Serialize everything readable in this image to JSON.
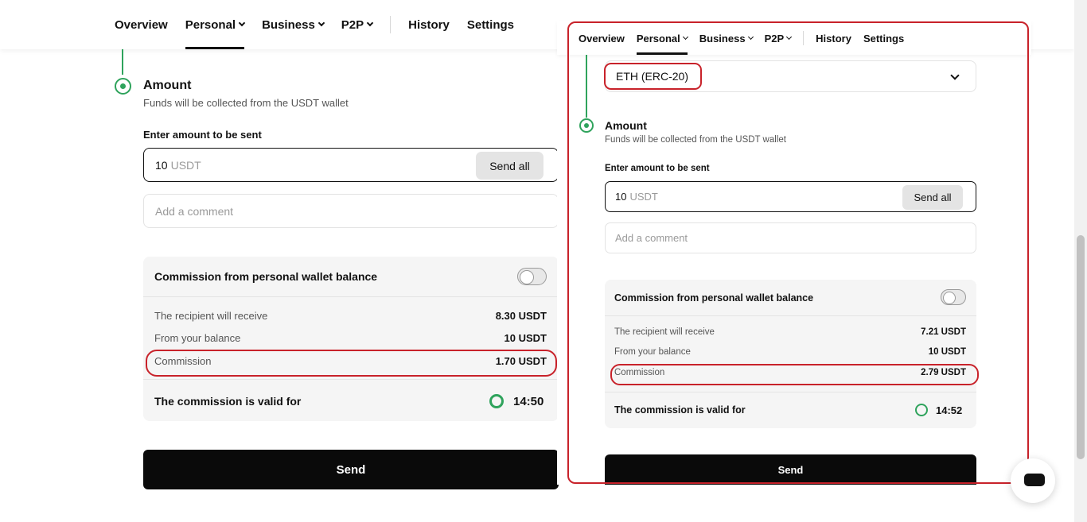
{
  "nav": {
    "items": [
      {
        "label": "Overview",
        "dropdown": false,
        "active": false
      },
      {
        "label": "Personal",
        "dropdown": true,
        "active": true
      },
      {
        "label": "Business",
        "dropdown": true,
        "active": false
      },
      {
        "label": "P2P",
        "dropdown": true,
        "active": false
      }
    ],
    "history": "History",
    "settings": "Settings"
  },
  "left": {
    "title": "Amount",
    "subtitle": "Funds will be collected from the USDT wallet",
    "amount_label": "Enter amount to be sent",
    "amount_value": "10",
    "amount_unit": "USDT",
    "send_all": "Send all",
    "comment_placeholder": "Add a comment",
    "commission_toggle_label": "Commission from personal wallet balance",
    "recipient_label": "The recipient will receive",
    "recipient_value": "8.30 USDT",
    "balance_label": "From your balance",
    "balance_value": "10 USDT",
    "commission_label": "Commission",
    "commission_value": "1.70 USDT",
    "valid_label": "The commission is valid for",
    "valid_time": "14:50",
    "send": "Send"
  },
  "right": {
    "network": "ETH (ERC-20)",
    "title": "Amount",
    "subtitle": "Funds will be collected from the USDT wallet",
    "amount_label": "Enter amount to be sent",
    "amount_value": "10",
    "amount_unit": "USDT",
    "send_all": "Send all",
    "comment_placeholder": "Add a comment",
    "commission_toggle_label": "Commission from personal wallet balance",
    "recipient_label": "The recipient will receive",
    "recipient_value": "7.21 USDT",
    "balance_label": "From your balance",
    "balance_value": "10 USDT",
    "commission_label": "Commission",
    "commission_value": "2.79 USDT",
    "valid_label": "The commission is valid for",
    "valid_time": "14:52",
    "send": "Send"
  },
  "colors": {
    "accent_green": "#2fa35c",
    "highlight_red": "#c8222a",
    "button_black": "#0a0a0a"
  }
}
